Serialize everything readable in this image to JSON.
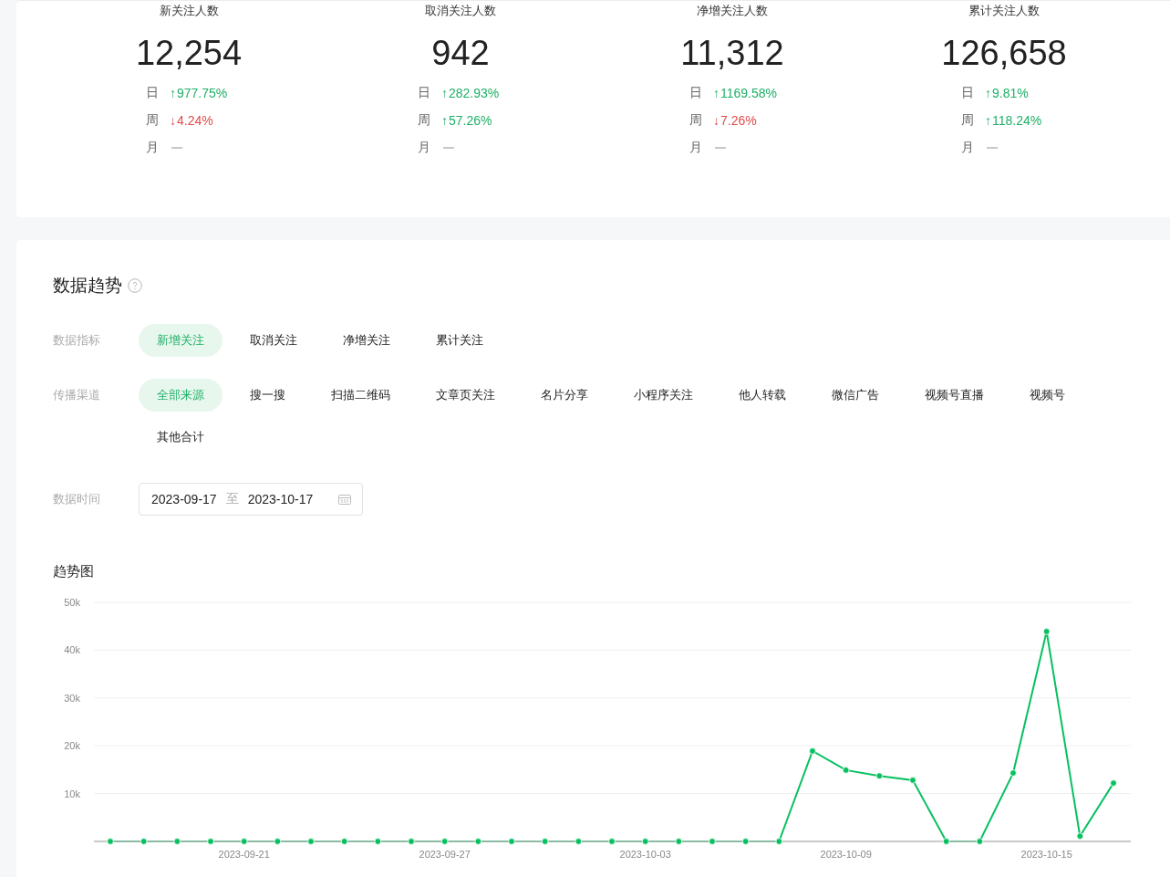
{
  "stats": [
    {
      "title": "新关注人数",
      "value": "12,254",
      "changes": [
        {
          "period": "日",
          "kind": "up",
          "arrow": "↑",
          "value": "977.75%"
        },
        {
          "period": "周",
          "kind": "down",
          "arrow": "↓",
          "value": "4.24%"
        },
        {
          "period": "月",
          "kind": "none"
        }
      ]
    },
    {
      "title": "取消关注人数",
      "value": "942",
      "changes": [
        {
          "period": "日",
          "kind": "up",
          "arrow": "↑",
          "value": "282.93%"
        },
        {
          "period": "周",
          "kind": "up",
          "arrow": "↑",
          "value": "57.26%"
        },
        {
          "period": "月",
          "kind": "none"
        }
      ]
    },
    {
      "title": "净增关注人数",
      "value": "11,312",
      "changes": [
        {
          "period": "日",
          "kind": "up",
          "arrow": "↑",
          "value": "1169.58%"
        },
        {
          "period": "周",
          "kind": "down",
          "arrow": "↓",
          "value": "7.26%"
        },
        {
          "period": "月",
          "kind": "none"
        }
      ]
    },
    {
      "title": "累计关注人数",
      "value": "126,658",
      "changes": [
        {
          "period": "日",
          "kind": "up",
          "arrow": "↑",
          "value": "9.81%"
        },
        {
          "period": "周",
          "kind": "up",
          "arrow": "↑",
          "value": "118.24%"
        },
        {
          "period": "月",
          "kind": "none"
        }
      ]
    }
  ],
  "trend": {
    "title": "数据趋势",
    "metric_filter": {
      "label": "数据指标",
      "options": [
        {
          "label": "新增关注",
          "selected": true
        },
        {
          "label": "取消关注",
          "selected": false
        },
        {
          "label": "净增关注",
          "selected": false
        },
        {
          "label": "累计关注",
          "selected": false
        }
      ]
    },
    "channel_filter": {
      "label": "传播渠道",
      "options": [
        {
          "label": "全部来源",
          "selected": true
        },
        {
          "label": "搜一搜",
          "selected": false
        },
        {
          "label": "扫描二维码",
          "selected": false
        },
        {
          "label": "文章页关注",
          "selected": false
        },
        {
          "label": "名片分享",
          "selected": false
        },
        {
          "label": "小程序关注",
          "selected": false
        },
        {
          "label": "他人转载",
          "selected": false
        },
        {
          "label": "微信广告",
          "selected": false
        },
        {
          "label": "视频号直播",
          "selected": false
        },
        {
          "label": "视频号",
          "selected": false
        },
        {
          "label": "其他合计",
          "selected": false
        }
      ]
    },
    "date_range": {
      "label": "数据时间",
      "start": "2023-09-17",
      "separator": "至",
      "end": "2023-10-17"
    },
    "chart_title": "趋势图",
    "chart_data": {
      "type": "line",
      "grid": true,
      "categories": [
        null,
        null,
        null,
        null,
        "2023-09-21",
        null,
        null,
        null,
        null,
        null,
        "2023-09-27",
        null,
        null,
        null,
        null,
        null,
        "2023-10-03",
        null,
        null,
        null,
        null,
        null,
        "2023-10-09",
        null,
        null,
        null,
        null,
        null,
        "2023-10-15",
        null,
        null
      ],
      "series": [
        {
          "color": "#07c160",
          "marker": "circle",
          "values": [
            0,
            0,
            0,
            0,
            0,
            0,
            0,
            0,
            0,
            0,
            0,
            0,
            0,
            0,
            0,
            0,
            0,
            0,
            0,
            0,
            0,
            18900,
            14900,
            13700,
            12800,
            0,
            0,
            14300,
            43900,
            1100,
            12200
          ]
        }
      ],
      "ylim": [
        0,
        50000
      ],
      "yticks": [
        {
          "value": 10000,
          "label": "10k"
        },
        {
          "value": 20000,
          "label": "20k"
        },
        {
          "value": 30000,
          "label": "30k"
        },
        {
          "value": 40000,
          "label": "40k"
        },
        {
          "value": 50000,
          "label": "50k"
        }
      ]
    }
  }
}
